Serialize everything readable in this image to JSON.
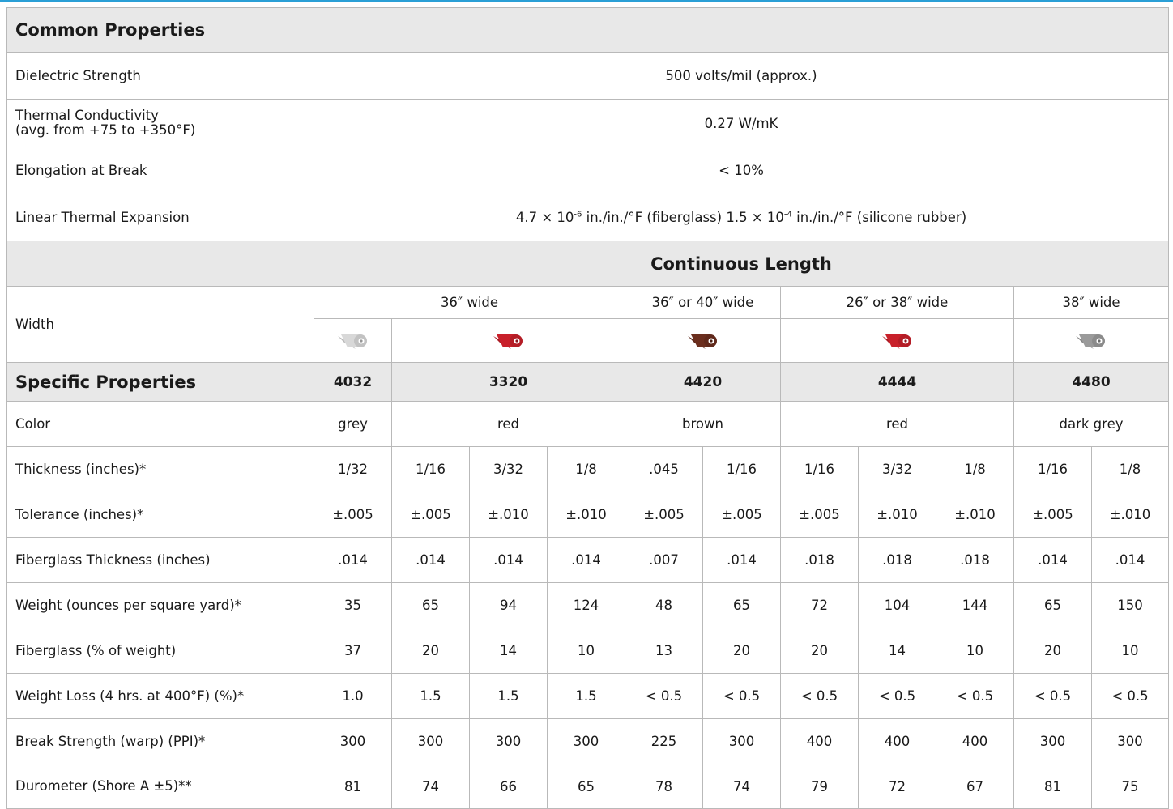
{
  "common": {
    "title": "Common Properties",
    "rows": [
      {
        "label": "Dielectric Strength",
        "value": "500 volts/mil (approx.)"
      },
      {
        "label_line1": "Thermal Conductivity",
        "label_line2": "(avg. from +75 to +350°F)",
        "value": "0.27 W/mK"
      },
      {
        "label": "Elongation at Break",
        "value": "< 10%"
      },
      {
        "label": "Linear Thermal Expansion",
        "v1": "4.7 × 10",
        "e1": "-6",
        "v2": " in./in./°F (fiberglass) 1.5 × 10",
        "e2": "-4",
        "v3": " in./in./°F (silicone rubber)"
      }
    ]
  },
  "continuous": {
    "title": "Continuous Length",
    "width_label": "Width",
    "widths": [
      "36″ wide",
      "36″ or 40″ wide",
      "26″ or 38″ wide",
      "38″ wide"
    ],
    "roll_colors": [
      "#d8d8d8",
      "#c8202a",
      "#6b2e1e",
      "#c8202a",
      "#9a9a9a"
    ]
  },
  "specific": {
    "title": "Specific Properties",
    "products": [
      "4032",
      "3320",
      "4420",
      "4444",
      "4480"
    ],
    "color_label": "Color",
    "colors": [
      "grey",
      "red",
      "brown",
      "red",
      "dark grey"
    ],
    "rows": [
      {
        "label": "Thickness (inches)*",
        "values": [
          "1/32",
          "1/16",
          "3/32",
          "1/8",
          ".045",
          "1/16",
          "1/16",
          "3/32",
          "1/8",
          "1/16",
          "1/8"
        ]
      },
      {
        "label": "Tolerance (inches)*",
        "values": [
          "±.005",
          "±.005",
          "±.010",
          "±.010",
          "±.005",
          "±.005",
          "±.005",
          "±.010",
          "±.010",
          "±.005",
          "±.010"
        ]
      },
      {
        "label": "Fiberglass Thickness (inches)",
        "values": [
          ".014",
          ".014",
          ".014",
          ".014",
          ".007",
          ".014",
          ".018",
          ".018",
          ".018",
          ".014",
          ".014"
        ]
      },
      {
        "label": "Weight (ounces per square yard)*",
        "values": [
          "35",
          "65",
          "94",
          "124",
          "48",
          "65",
          "72",
          "104",
          "144",
          "65",
          "150"
        ]
      },
      {
        "label": "Fiberglass (% of weight)",
        "values": [
          "37",
          "20",
          "14",
          "10",
          "13",
          "20",
          "20",
          "14",
          "10",
          "20",
          "10"
        ]
      },
      {
        "label": "Weight Loss (4 hrs. at 400°F) (%)*",
        "values": [
          "1.0",
          "1.5",
          "1.5",
          "1.5",
          "< 0.5",
          "< 0.5",
          "< 0.5",
          "< 0.5",
          "< 0.5",
          "< 0.5",
          "< 0.5"
        ]
      },
      {
        "label": "Break Strength (warp) (PPI)*",
        "values": [
          "300",
          "300",
          "300",
          "300",
          "225",
          "300",
          "400",
          "400",
          "400",
          "300",
          "300"
        ]
      },
      {
        "label": "Durometer (Shore A ±5)**",
        "values": [
          "81",
          "74",
          "66",
          "65",
          "78",
          "74",
          "79",
          "72",
          "67",
          "81",
          "75"
        ]
      }
    ]
  }
}
